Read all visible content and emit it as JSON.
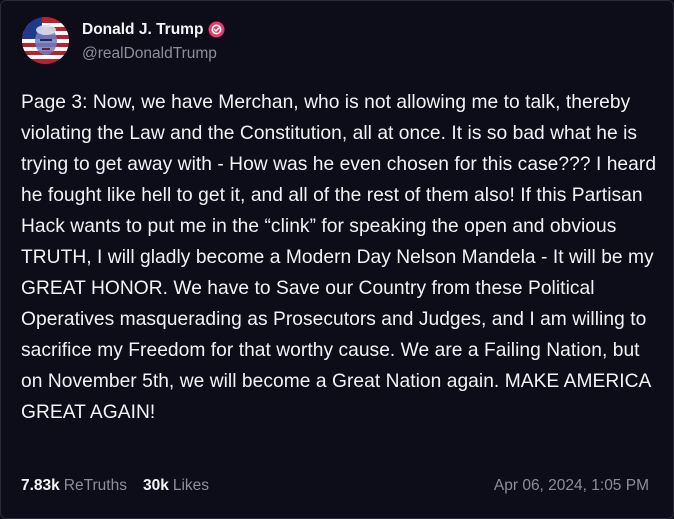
{
  "author": {
    "display_name": "Donald J. Trump",
    "handle": "@realDonaldTrump",
    "verified_icon": "verified-badge-icon"
  },
  "post": {
    "text": "Page 3: Now, we have Merchan, who is not allowing me to talk, thereby violating the Law and the Constitution, all at once. It is so bad what he is trying to get away with - How was he even chosen for this case??? I heard he fought like hell to get it, and all of the rest of them also! If this Partisan Hack wants to put me in the “clink” for speaking the open and obvious TRUTH, I will gladly become a Modern Day Nelson Mandela - It will be my GREAT HONOR. We have to Save our Country from these Political Operatives masquerading as Prosecutors and Judges, and I am willing to sacrifice my Freedom for that worthy cause. We are a Failing Nation, but on November 5th, we will become a Great Nation again. MAKE AMERICA GREAT AGAIN!",
    "retruths_count": "7.83k",
    "retruths_label": "ReTruths",
    "likes_count": "30k",
    "likes_label": "Likes",
    "timestamp": "Apr 06, 2024, 1:05 PM"
  },
  "colors": {
    "background": "#0d0d1a",
    "text": "#f3f3f6",
    "muted": "#8d8d9b",
    "verified_badge": "#e83a6a"
  }
}
